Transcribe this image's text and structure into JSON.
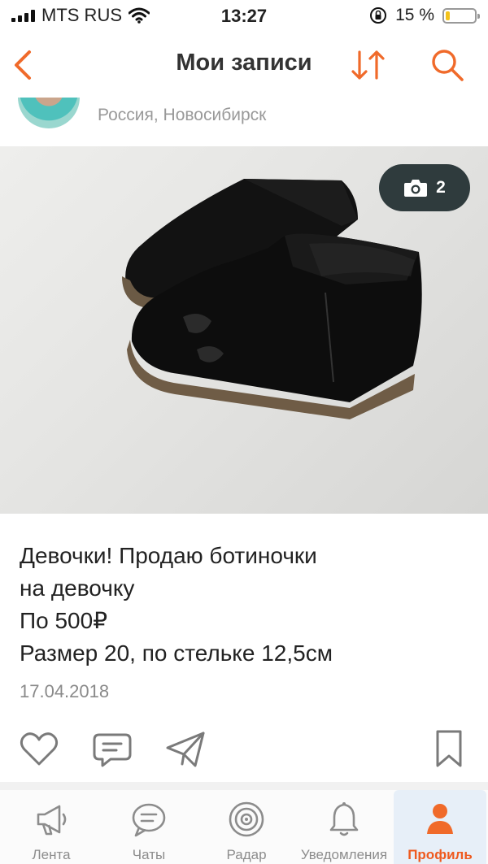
{
  "status_bar": {
    "carrier": "MTS RUS",
    "time": "13:27",
    "battery_text": "15 %",
    "battery_level": 0.15
  },
  "header": {
    "title": "Мои записи"
  },
  "post": {
    "author_location": "Россия, Новосибирск",
    "photo_count": "2",
    "text": "Девочки! Продаю ботиночки\nна девочку\nПо 500₽\nРазмер 20, по стельке 12,5см",
    "date": "17.04.2018"
  },
  "tabs": [
    {
      "label": "Лента",
      "icon": "megaphone-icon"
    },
    {
      "label": "Чаты",
      "icon": "chat-icon"
    },
    {
      "label": "Радар",
      "icon": "radar-icon"
    },
    {
      "label": "Уведомления",
      "icon": "bell-icon"
    },
    {
      "label": "Профиль",
      "icon": "person-icon",
      "active": true
    }
  ],
  "colors": {
    "accent": "#f06a2a",
    "icon_gray": "#7a7a7a",
    "active_tab_bg": "#e7eff8",
    "photo_badge_bg": "#2f3b3d"
  }
}
